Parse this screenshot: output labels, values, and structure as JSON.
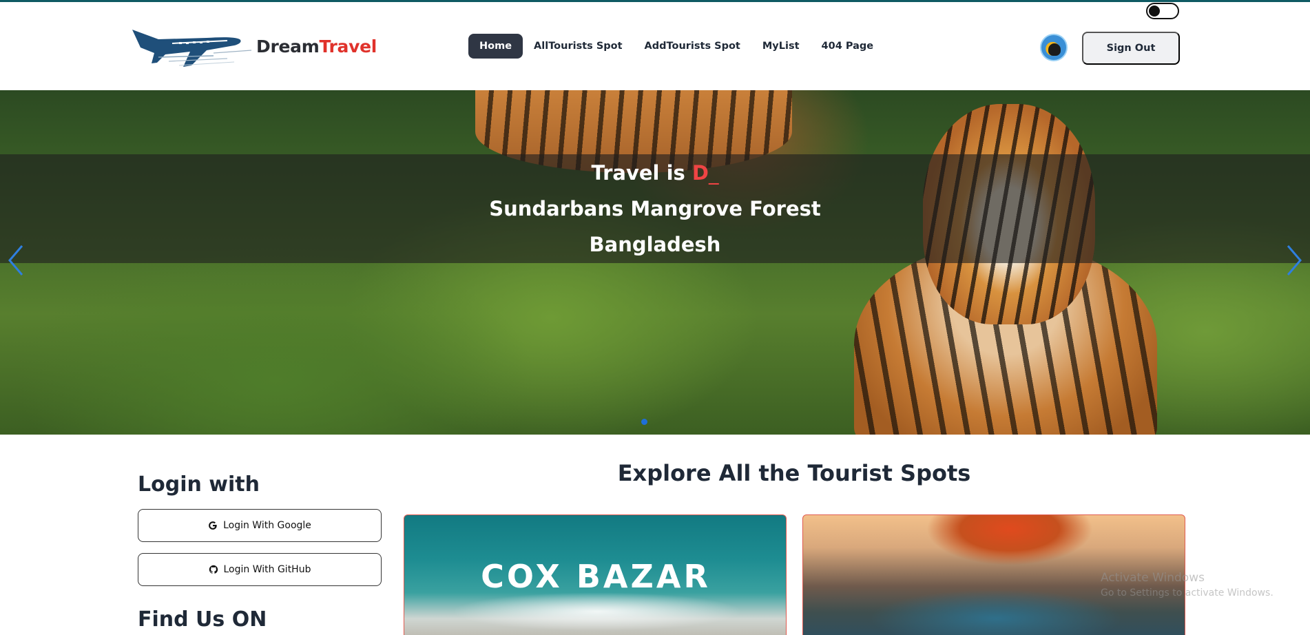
{
  "brand": {
    "part1": "Dream",
    "part2": "Travel"
  },
  "nav": {
    "items": [
      {
        "label": "Home",
        "active": true
      },
      {
        "label": "AllTourists Spot",
        "active": false
      },
      {
        "label": "AddTourists Spot",
        "active": false
      },
      {
        "label": "MyList",
        "active": false
      },
      {
        "label": "404 Page",
        "active": false
      }
    ],
    "sign_out": "Sign Out"
  },
  "hero": {
    "line1_prefix": "Travel is ",
    "line1_typed": "D",
    "line1_cursor": "_",
    "line2": "Sundarbans Mangrove Forest",
    "line3": "Bangladesh",
    "slide_index": 1
  },
  "login": {
    "heading": "Login with",
    "google": "Login With Google",
    "github": "Login With GitHub"
  },
  "find_us": {
    "heading": "Find Us ON"
  },
  "explore": {
    "heading": "Explore All the Tourist Spots",
    "cards": [
      {
        "label": "COX BAZAR"
      },
      {
        "label": ""
      }
    ]
  },
  "watermark": {
    "line1": "Activate Windows",
    "line2": "Go to Settings to activate Windows."
  },
  "colors": {
    "accent": "#e0322b",
    "nav_active_bg": "#2f3644",
    "top_bar": "#0f5a63"
  }
}
